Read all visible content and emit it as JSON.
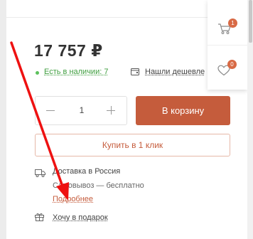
{
  "product": {
    "price": "17 757 ₽",
    "stock": "Есть в наличии: 7",
    "found_cheaper": "Нашли дешевле"
  },
  "quantity": {
    "value": "1"
  },
  "buttons": {
    "add_to_cart": "В корзину",
    "buy_one_click": "Купить в 1 клик"
  },
  "delivery": {
    "title": "Доставка в Россия",
    "pickup": "Самовывоз — бесплатно",
    "more": "Подробнее"
  },
  "gift": "Хочу в подарок",
  "side_panel": {
    "cart_count": "1",
    "favorites_count": "0",
    "cart_icon": "cart-icon",
    "favorites_icon": "heart-icon"
  },
  "colors": {
    "accent": "#c55c3c",
    "badge": "#d86a45",
    "in_stock": "#3f9e3f",
    "annotation_arrow": "#ee1111"
  }
}
